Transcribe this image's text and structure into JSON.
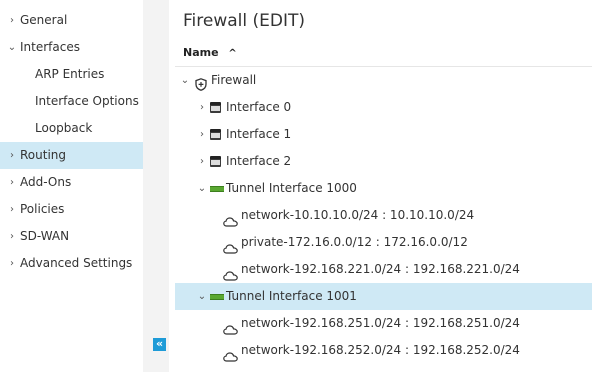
{
  "sidebar": {
    "items": [
      {
        "label": "General",
        "chevron": "›"
      },
      {
        "label": "Interfaces",
        "chevron": "⌄"
      },
      {
        "label": "ARP Entries"
      },
      {
        "label": "Interface Options"
      },
      {
        "label": "Loopback"
      },
      {
        "label": "Routing",
        "chevron": "›"
      },
      {
        "label": "Add-Ons",
        "chevron": "›"
      },
      {
        "label": "Policies",
        "chevron": "›"
      },
      {
        "label": "SD-WAN",
        "chevron": "›"
      },
      {
        "label": "Advanced Settings",
        "chevron": "›"
      }
    ],
    "collapse_glyph": "«"
  },
  "main": {
    "title": "Firewall (EDIT)",
    "column_header": "Name",
    "sort_glyph": "^",
    "tree": [
      {
        "label": "Firewall",
        "chevron": "⌄"
      },
      {
        "label": "Interface 0",
        "chevron": "›"
      },
      {
        "label": "Interface 1",
        "chevron": "›"
      },
      {
        "label": "Interface 2",
        "chevron": "›"
      },
      {
        "label": "Tunnel Interface 1000",
        "chevron": "⌄"
      },
      {
        "label": "network-10.10.10.0/24 : 10.10.10.0/24"
      },
      {
        "label": "private-172.16.0.0/12 : 172.16.0.0/12"
      },
      {
        "label": "network-192.168.221.0/24 : 192.168.221.0/24"
      },
      {
        "label": "Tunnel Interface 1001",
        "chevron": "⌄"
      },
      {
        "label": "network-192.168.251.0/24 : 192.168.251.0/24"
      },
      {
        "label": "network-192.168.252.0/24 : 192.168.252.0/24"
      }
    ]
  },
  "colors": {
    "accent": "#1e9bd7",
    "selected_bg": "#cfe9f5",
    "tunnel_green": "#5aa831"
  }
}
